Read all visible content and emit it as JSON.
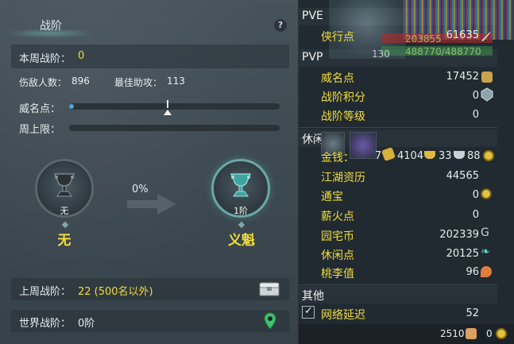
{
  "left": {
    "title": "战阶",
    "help": "?",
    "weekly_rank_label": "本周战阶：",
    "weekly_rank_value": "0",
    "kills_label": "伤敌人数：",
    "kills_value": "896",
    "assists_label": "最佳助攻：",
    "assists_value": "113",
    "prestige_label": "威名点：",
    "weekly_cap_label": "周上限：",
    "current_rank": {
      "badge": "无",
      "name": "无"
    },
    "progress_percent": "0%",
    "next_rank": {
      "badge": "1阶",
      "name": "义魁"
    },
    "last_week_label": "上周战阶：",
    "last_week_value": "22 (500名以外)",
    "world_rank_label": "世界战阶：",
    "world_rank_value": "0阶",
    "prestige_progress": 0.02,
    "cap_progress": 0.0
  },
  "right": {
    "overlay": {
      "hp": "203855",
      "mp": "488770/488770",
      "level": "130"
    },
    "pve": {
      "title": "PVE",
      "items": [
        {
          "label": "侠行点",
          "value": "61635"
        }
      ]
    },
    "pvp": {
      "title": "PVP",
      "items": [
        {
          "label": "威名点",
          "value": "17452"
        },
        {
          "label": "战阶积分",
          "value": "0"
        },
        {
          "label": "战阶等级",
          "value": "0"
        }
      ]
    },
    "leisure": {
      "title": "休闲",
      "money_label": "金钱：",
      "money_a": "7",
      "money_b": "4104",
      "money_c": "33",
      "money_d": "88",
      "items": [
        {
          "label": "江湖资历",
          "value": "44565"
        },
        {
          "label": "通宝",
          "value": "0"
        },
        {
          "label": "薪火点",
          "value": "0"
        },
        {
          "label": "园宅币",
          "value": "202339"
        },
        {
          "label": "休闲点",
          "value": "20125"
        },
        {
          "label": "桃李值",
          "value": "96"
        }
      ]
    },
    "other": {
      "title": "其他",
      "items": [
        {
          "label": "网络延迟",
          "value": "52"
        }
      ]
    },
    "bottom": {
      "a": "2510",
      "b": "0"
    }
  },
  "colors": {
    "accent_yellow": "#f2dd3c",
    "teal": "#6aa8a4",
    "blue_fill": "#4aa6e0"
  }
}
